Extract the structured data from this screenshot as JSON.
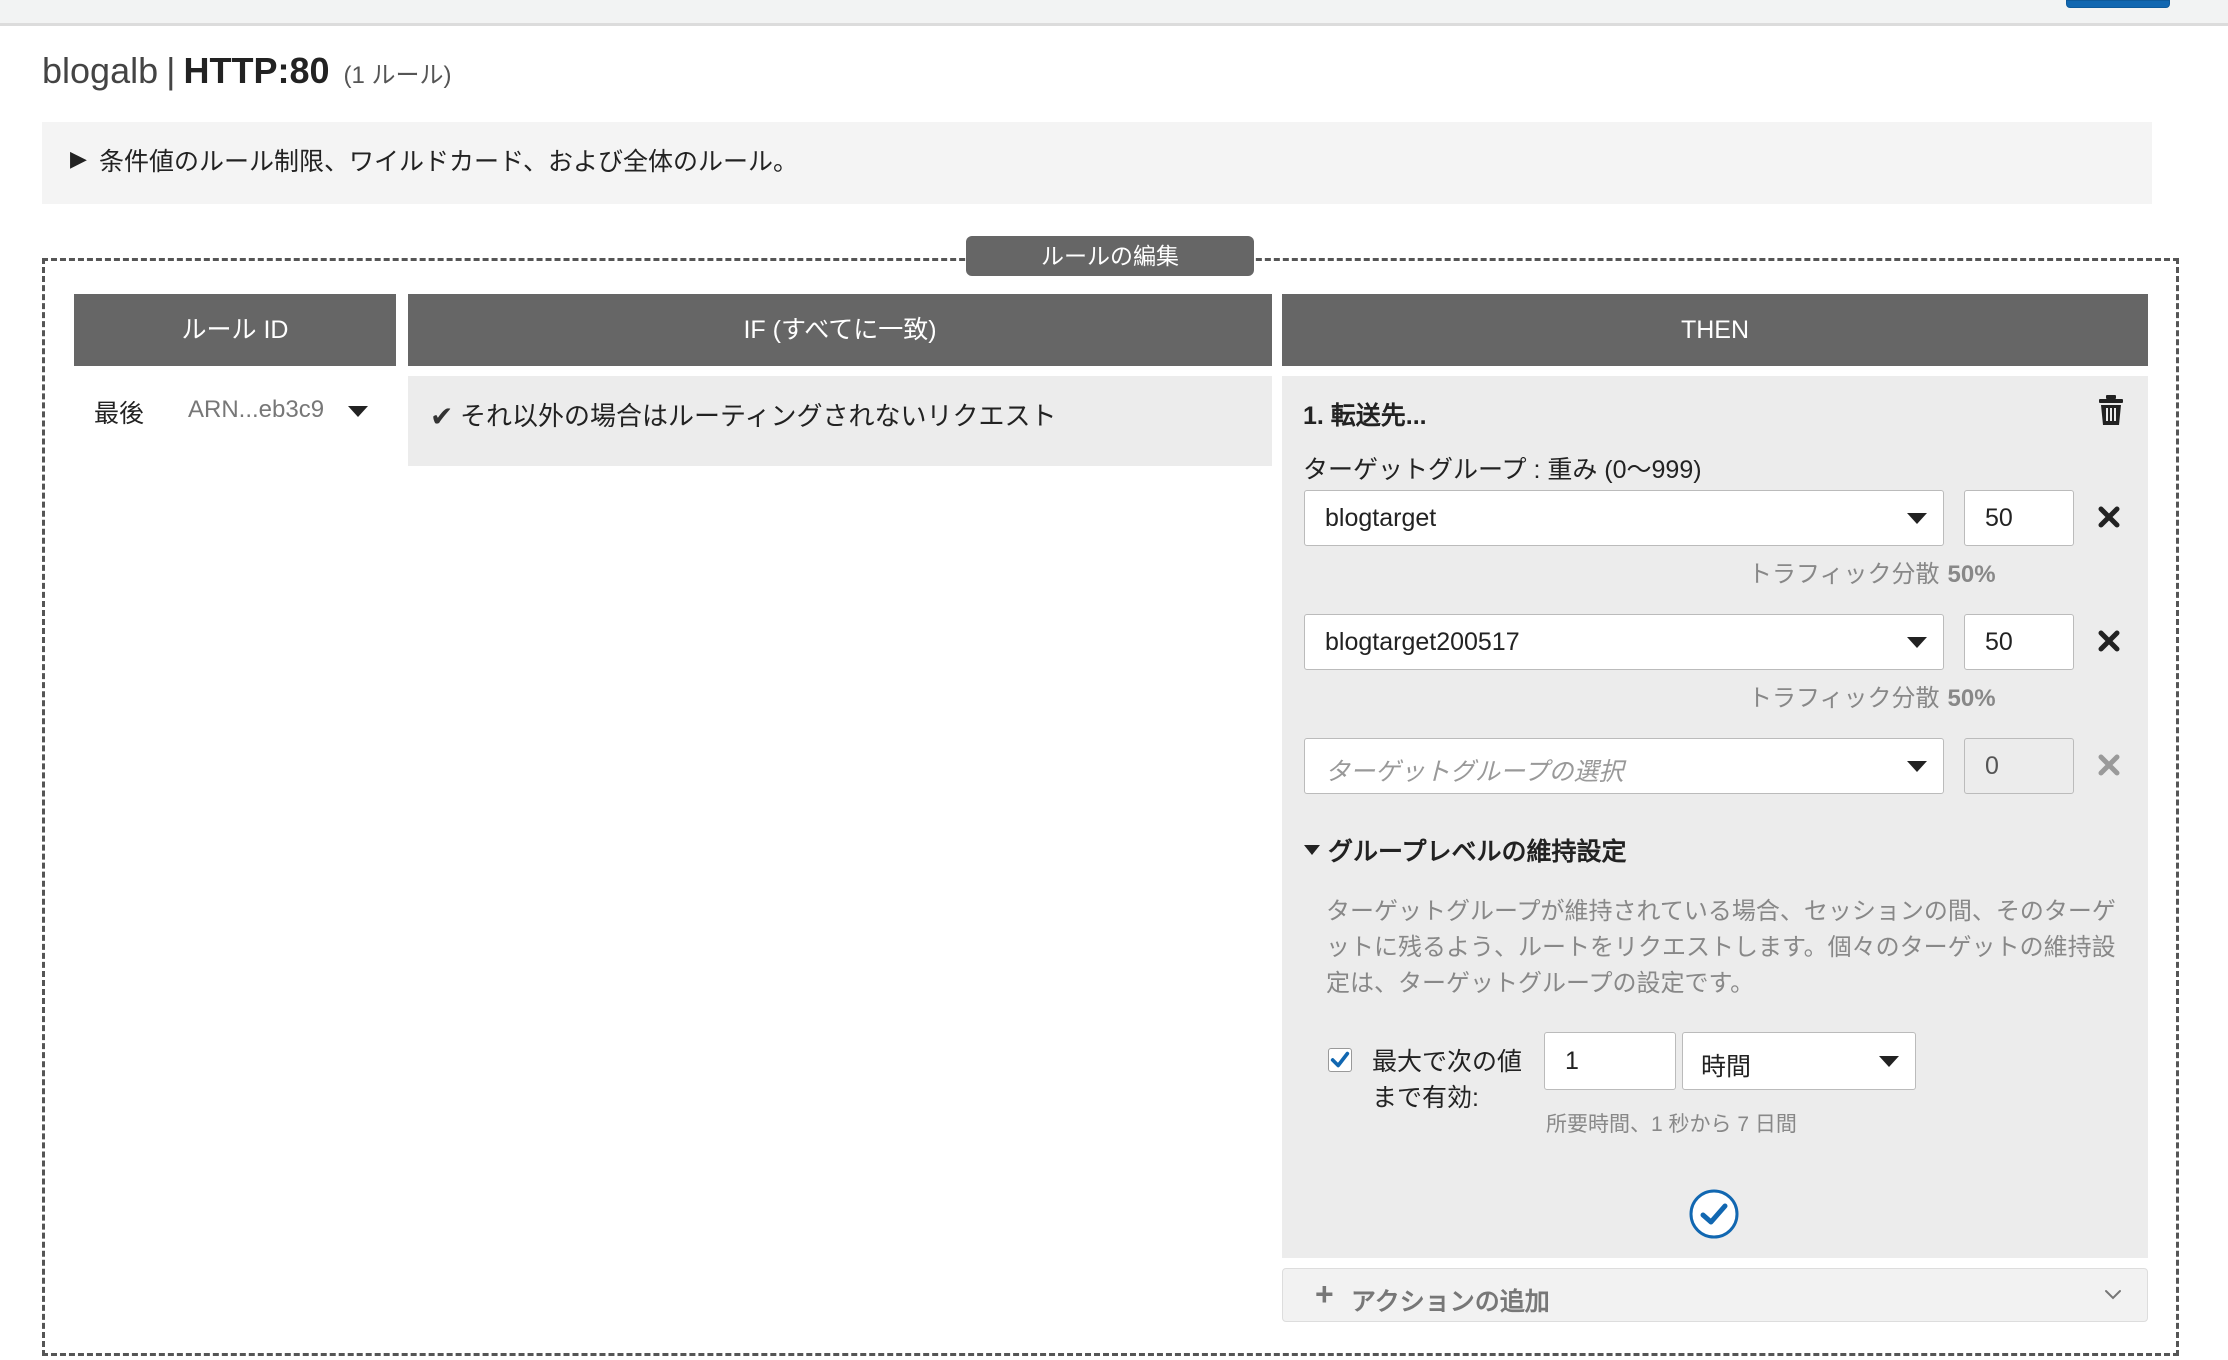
{
  "header": {
    "lb_name": "blogalb",
    "separator": "|",
    "listener": "HTTP:80",
    "rule_count": "(1 ルール)"
  },
  "info_bar": {
    "text": "条件値のルール制限、ワイルドカード、および全体のルール。"
  },
  "edit_tab": {
    "label": "ルールの編集"
  },
  "columns": {
    "rule_id": "ルール ID",
    "if": "IF (すべてに一致)",
    "then": "THEN"
  },
  "rule": {
    "priority": "最後",
    "arn": "ARN...eb3c9",
    "condition": "それ以外の場合はルーティングされないリクエスト"
  },
  "action": {
    "title": "1. 転送先...",
    "target_group_label": "ターゲットグループ : 重み (0〜999)",
    "targets": [
      {
        "name": "blogtarget",
        "weight": "50",
        "traffic_label": "トラフィック分散",
        "traffic_pct": "50%"
      },
      {
        "name": "blogtarget200517",
        "weight": "50",
        "traffic_label": "トラフィック分散",
        "traffic_pct": "50%"
      }
    ],
    "new_target": {
      "placeholder": "ターゲットグループの選択",
      "weight": "0"
    },
    "stickiness": {
      "heading": "グループレベルの維持設定",
      "description": "ターゲットグループが維持されている場合、セッションの間、そのターゲットに残るよう、ルートをリクエストします。個々のターゲットの維持設定は、ターゲットグループの設定です。",
      "checkbox_label": "最大で次の値まで有効:",
      "checked": true,
      "duration_value": "1",
      "duration_unit": "時間",
      "duration_hint": "所要時間、1 秒から 7 日間"
    }
  },
  "add_action": {
    "label": "アクションの追加"
  },
  "colors": {
    "header_gray": "#666666",
    "panel_gray": "#ececec",
    "accent_blue": "#1167b1"
  },
  "icons": {
    "trash": "trash-icon",
    "remove": "close-icon",
    "check": "checkmark-icon",
    "confirm": "check-circle-icon",
    "plus": "plus-icon",
    "chevron": "chevron-down-icon"
  }
}
